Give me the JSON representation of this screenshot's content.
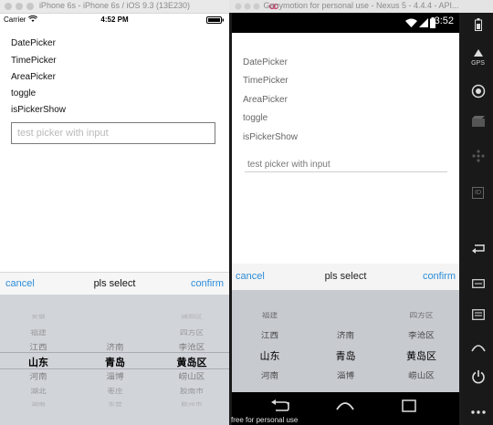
{
  "ios": {
    "window_title": "iPhone 6s - iPhone 6s / iOS 9.3 (13E230)",
    "status": {
      "carrier": "Carrier",
      "time": "4:52 PM"
    },
    "menu": [
      "DatePicker",
      "TimePicker",
      "AreaPicker",
      "toggle",
      "isPickerShow"
    ],
    "input": {
      "placeholder": "test picker with input",
      "value": ""
    },
    "picker": {
      "cancel": "cancel",
      "title": "pls select",
      "confirm": "confirm",
      "columns": [
        [
          "安徽",
          "福建",
          "江西",
          "山东",
          "河南",
          "湖北",
          "湖南"
        ],
        [
          "济南",
          "青岛",
          "淄博",
          "枣庄",
          "东营"
        ],
        [
          "城阳区",
          "四方区",
          "李沧区",
          "黄岛区",
          "崂山区",
          "胶南市",
          "胶州市"
        ]
      ],
      "selected": [
        "山东",
        "青岛",
        "黄岛区"
      ]
    }
  },
  "android": {
    "window_title": "Genymotion for personal use - Nexus 5 - 4.4.4 - API...",
    "status": {
      "time": "3:52"
    },
    "menu": [
      "DatePicker",
      "TimePicker",
      "AreaPicker",
      "toggle",
      "isPickerShow"
    ],
    "input": {
      "value": "test picker with input"
    },
    "picker": {
      "cancel": "cancel",
      "title": "pls select",
      "confirm": "confirm",
      "columns": [
        [
          "福建",
          "江西",
          "山东",
          "河南",
          "湖北"
        ],
        [
          "济南",
          "青岛",
          "淄博",
          "枣庄"
        ],
        [
          "四方区",
          "李沧区",
          "黄岛区",
          "崂山区",
          "胶南市"
        ]
      ],
      "selected": [
        "山东",
        "青岛",
        "黄岛区"
      ]
    },
    "footer": "free for personal use",
    "toolbar_icons": [
      "battery-icon",
      "gps-icon",
      "camera-icon",
      "video-icon",
      "dpad-icon",
      "id-icon",
      "back-icon",
      "recent-apps-icon",
      "menu-icon",
      "home-icon",
      "power-icon",
      "more-icon"
    ],
    "toolbar_labels": {
      "gps": "GPS",
      "id": "ID"
    }
  },
  "colors": {
    "accent": "#2d8cd8",
    "wheel_ios": "#d1d4d9",
    "wheel_android": "#c7cacf"
  }
}
